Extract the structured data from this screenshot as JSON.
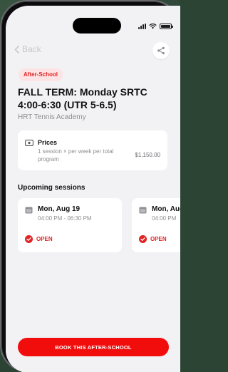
{
  "status_bar": {
    "time": ""
  },
  "nav": {
    "back_label": "Back"
  },
  "program": {
    "tag": "After-School",
    "title": "FALL TERM: Monday SRTC 4:00-6:30 (UTR 5-6.5)",
    "academy": "HRT Tennis Academy"
  },
  "prices": {
    "label": "Prices",
    "description": "1 session × per week per total program",
    "amount": "$1,150.00",
    "icon": "ticket-icon"
  },
  "sessions": {
    "heading": "Upcoming sessions",
    "items": [
      {
        "date": "Mon, Aug 19",
        "time": "04:00 PM - 06:30 PM",
        "status": "OPEN"
      },
      {
        "date": "Mon, Aug",
        "time": "04:00 PM",
        "status": "OPEN"
      }
    ]
  },
  "cta": {
    "label": "BOOK THIS AFTER-SCHOOL"
  },
  "colors": {
    "accent": "#f20d0d",
    "tag_bg": "#fde3e3",
    "tag_text": "#e02424",
    "screen_bg": "#f2f2f5"
  }
}
